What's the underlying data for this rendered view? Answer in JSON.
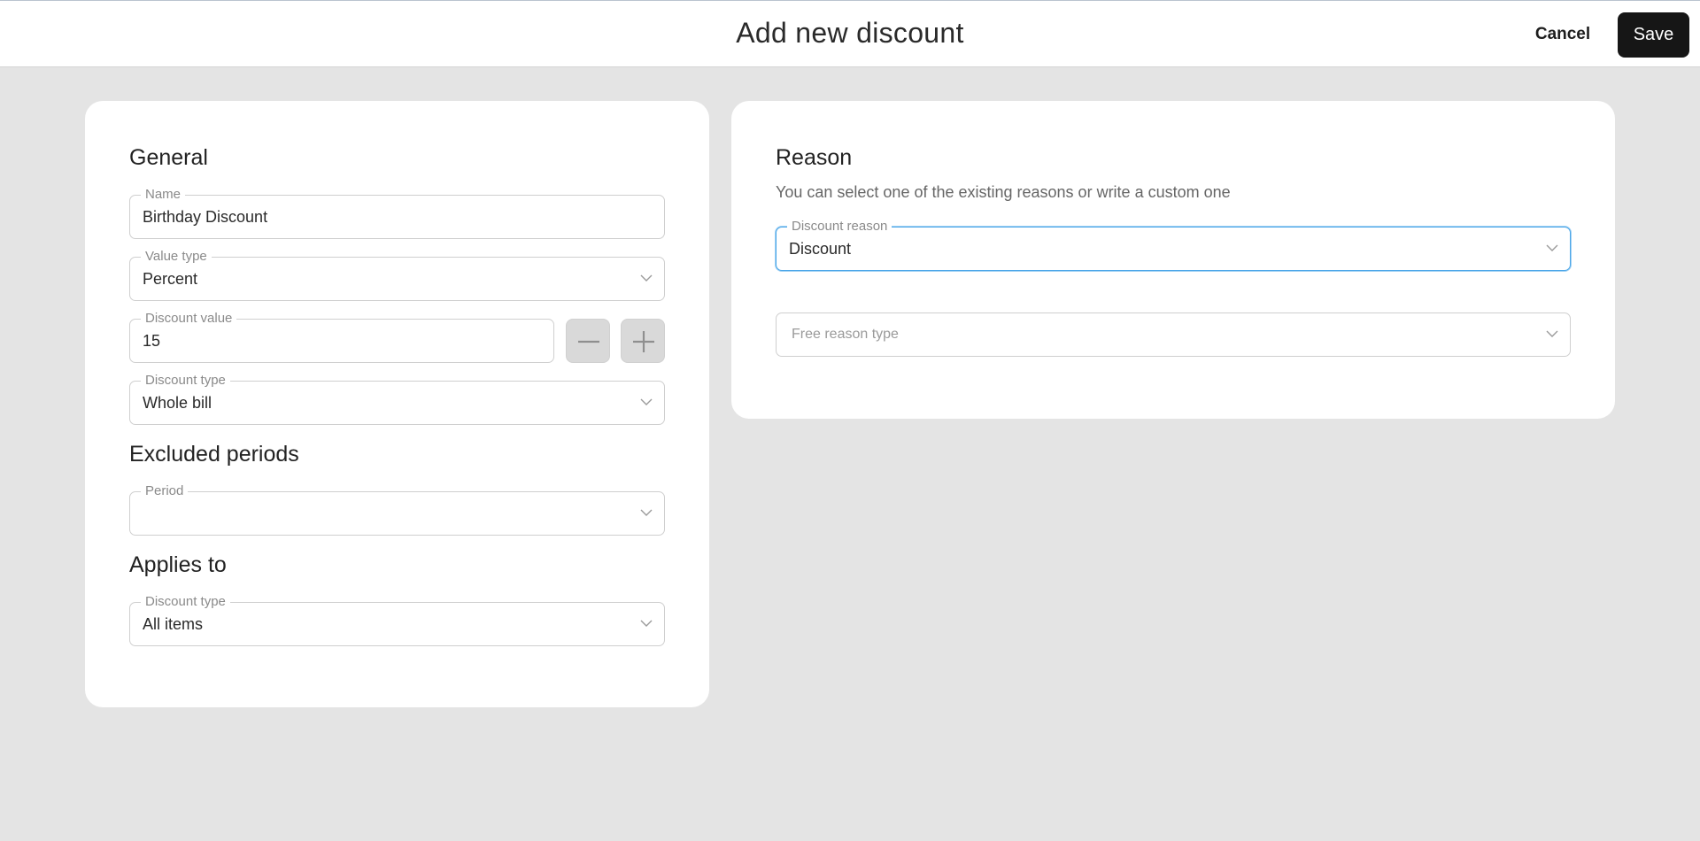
{
  "header": {
    "title": "Add new discount",
    "cancel_label": "Cancel",
    "save_label": "Save"
  },
  "general": {
    "title": "General",
    "name": {
      "label": "Name",
      "value": "Birthday Discount"
    },
    "value_type": {
      "label": "Value type",
      "value": "Percent"
    },
    "discount_value": {
      "label": "Discount value",
      "value": "15"
    },
    "discount_type": {
      "label": "Discount type",
      "value": "Whole bill"
    }
  },
  "excluded_periods": {
    "title": "Excluded periods",
    "period": {
      "label": "Period",
      "value": ""
    }
  },
  "applies_to": {
    "title": "Applies to",
    "discount_type": {
      "label": "Discount type",
      "value": "All items"
    }
  },
  "reason": {
    "title": "Reason",
    "subtitle": "You can select one of the existing reasons or write a custom one",
    "discount_reason": {
      "label": "Discount reason",
      "value": "Discount"
    },
    "free_reason_type": {
      "placeholder": "Free reason type"
    }
  },
  "icons": {
    "chevron": "chevron-down-icon",
    "minus": "minus-icon",
    "plus": "plus-icon"
  },
  "colors": {
    "background": "#e4e4e4",
    "card": "#ffffff",
    "save_button": "#161616",
    "focus_border": "#4aa6e8"
  }
}
